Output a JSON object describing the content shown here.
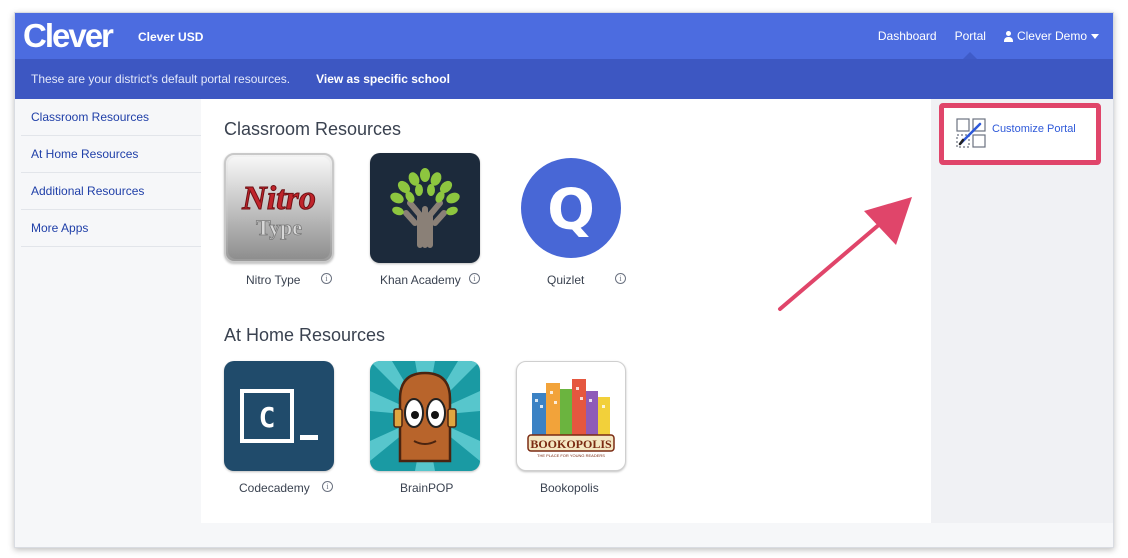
{
  "header": {
    "logo": "Clever",
    "district": "Clever USD",
    "nav": {
      "dashboard": "Dashboard",
      "portal": "Portal",
      "user": "Clever Demo"
    }
  },
  "subbar": {
    "note": "These are your district's default portal resources.",
    "link": "View as specific school"
  },
  "sidebar": {
    "items": [
      {
        "label": "Classroom Resources"
      },
      {
        "label": "At Home Resources"
      },
      {
        "label": "Additional Resources"
      },
      {
        "label": "More Apps"
      }
    ]
  },
  "sections": [
    {
      "title": "Classroom Resources",
      "apps": [
        {
          "name": "Nitro Type",
          "info": true
        },
        {
          "name": "Khan Academy",
          "info": true
        },
        {
          "name": "Quizlet",
          "info": true
        }
      ]
    },
    {
      "title": "At Home Resources",
      "apps": [
        {
          "name": "Codecademy",
          "info": true
        },
        {
          "name": "BrainPOP",
          "info": false
        },
        {
          "name": "Bookopolis",
          "info": false
        }
      ]
    }
  ],
  "tiles": {
    "nitro_word1": "Nitro",
    "nitro_word2": "Type",
    "quizlet_letter": "Q",
    "codecademy_letter": "C",
    "bookopolis_word": "BOOKOPOLIS",
    "bookopolis_tagline": "THE PLACE FOR YOUNG READERS"
  },
  "info_glyph": "i",
  "customize": {
    "label": "Customize Portal"
  },
  "colors": {
    "topbar": "#4c6ce0",
    "subbar": "#3d57c2",
    "link": "#1f3fa8",
    "highlight": "#e0456a"
  }
}
